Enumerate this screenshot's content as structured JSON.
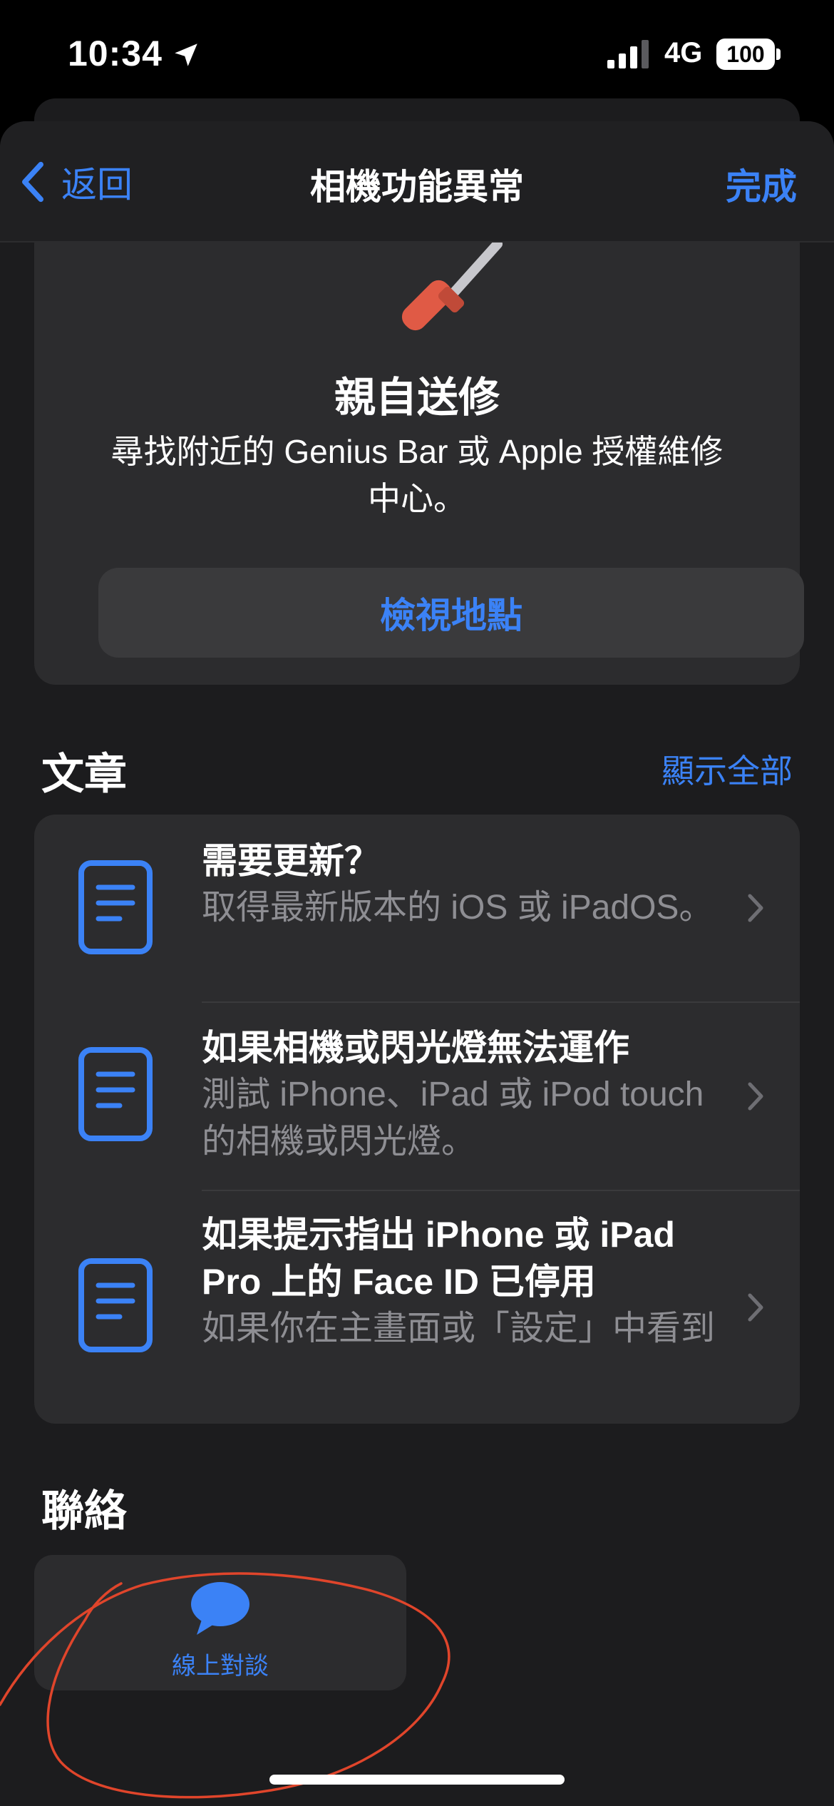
{
  "status_bar": {
    "time": "10:34",
    "network": "4G",
    "battery": "100"
  },
  "nav": {
    "back_label": "返回",
    "title": "相機功能異常",
    "done_label": "完成"
  },
  "service": {
    "title": "親自送修",
    "description": "尋找附近的 Genius Bar 或 Apple 授權維修中心。",
    "button_label": "檢視地點"
  },
  "articles": {
    "section_title": "文章",
    "show_all": "顯示全部",
    "items": [
      {
        "title": "需要更新？",
        "description": "取得最新版本的 iOS 或 iPadOS。"
      },
      {
        "title": "如果相機或閃光燈無法運作",
        "description": "測試 iPhone、iPad 或 iPod touch 的相機或閃光燈。"
      },
      {
        "title": "如果提示指出 iPhone 或 iPad Pro 上的 Face ID 已停用",
        "description": "如果你在主畫面或「設定」中看到此訊息，表示 iPhone 或 i..."
      }
    ]
  },
  "contact": {
    "section_title": "聯絡",
    "chat_label": "線上對談"
  },
  "colors": {
    "accent": "#3b82f6",
    "background": "#1c1c1e",
    "card": "#2c2c2e",
    "annotation": "#e0452b"
  },
  "icons": [
    "location-arrow-icon",
    "cellular-signal-icon",
    "battery-icon",
    "chevron-left-icon",
    "screwdriver-icon",
    "document-icon",
    "chevron-right-icon",
    "chat-bubble-icon"
  ]
}
